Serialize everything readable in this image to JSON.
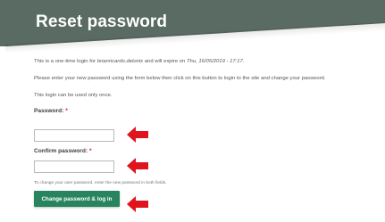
{
  "header": {
    "title": "Reset password",
    "color": "#5a6b63"
  },
  "content": {
    "info_prefix": "This is a one-time login for ",
    "username": "brianricardo.delonix",
    "info_middle": " and will expire on ",
    "expiry": "Thu, 16/05/2019 - 17:17",
    "info_suffix": ".",
    "instructions": "Please enter your new password using the form below then click on this button to login to the site and change your password.",
    "once_note": "This login can be used only once."
  },
  "form": {
    "password_label": "Password:",
    "confirm_label": "Confirm password:",
    "required_mark": "*",
    "hint": "To change your user password, enter the new password in both fields.",
    "submit_label": "Change password & log in",
    "submit_color": "#28845f"
  },
  "annotations": {
    "arrow_color": "#e0141c",
    "arrow_icon": "left-arrow-icon"
  }
}
